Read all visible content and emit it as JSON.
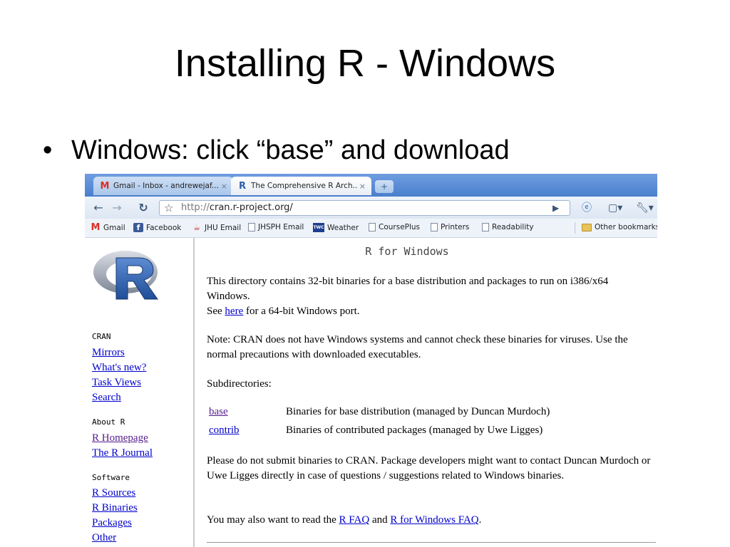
{
  "slide": {
    "title": "Installing R - Windows",
    "bullet_mark": "•",
    "bullet_text": "Windows: click “base” and download"
  },
  "browser": {
    "tabs": [
      {
        "label": "Gmail - Inbox - andrewejaf...",
        "close": "×"
      },
      {
        "label": "The Comprehensive R Arch...",
        "close": "×"
      }
    ],
    "new_tab": "+",
    "url": {
      "protocol": "http://",
      "rest": "cran.r-project.org/"
    },
    "bookmarks": [
      {
        "label": "Gmail",
        "icon": "gmail-icon"
      },
      {
        "label": "Facebook",
        "icon": "facebook-icon"
      },
      {
        "label": "JHU Email",
        "icon": "java-icon"
      },
      {
        "label": "JHSPH Email",
        "icon": "page-icon"
      },
      {
        "label": "Weather",
        "icon": "weather-channel-icon"
      },
      {
        "label": "CoursePlus",
        "icon": "page-icon"
      },
      {
        "label": "Printers",
        "icon": "page-icon"
      },
      {
        "label": "Readability",
        "icon": "page-icon"
      }
    ],
    "other_bookmarks": "Other bookmarks"
  },
  "page": {
    "heading": "R for Windows",
    "sidebar": {
      "cran_head": "CRAN",
      "cran_links": [
        "Mirrors",
        "What's new?",
        "Task Views",
        "Search"
      ],
      "about_head": "About R",
      "about_links": [
        "R Homepage",
        "The R Journal"
      ],
      "software_head": "Software",
      "software_links": [
        "R Sources",
        "R Binaries",
        "Packages",
        "Other"
      ]
    },
    "intro_line1": "This directory contains 32-bit binaries for a base distribution and packages to run on i386/x64 Windows.",
    "see_prefix": "See ",
    "see_link": "here",
    "see_suffix": " for a 64-bit Windows port.",
    "note": "Note: CRAN does not have Windows systems and cannot check these binaries for viruses. Use the normal precautions with downloaded executables.",
    "subdirs_label": "Subdirectories:",
    "subdirs": [
      {
        "name": "base",
        "desc": "Binaries for base distribution (managed by Duncan Murdoch)"
      },
      {
        "name": "contrib",
        "desc": "Binaries of contributed packages (managed by Uwe Ligges)"
      }
    ],
    "please": "Please do not submit binaries to CRAN. Package developers might want to contact Duncan Murdoch or Uwe Ligges directly in case of questions / suggestions related to Windows binaries.",
    "faq_prefix": "You may also want to read the ",
    "faq_link1": "R FAQ",
    "faq_mid": " and ",
    "faq_link2": "R for Windows FAQ",
    "faq_suffix": "."
  }
}
